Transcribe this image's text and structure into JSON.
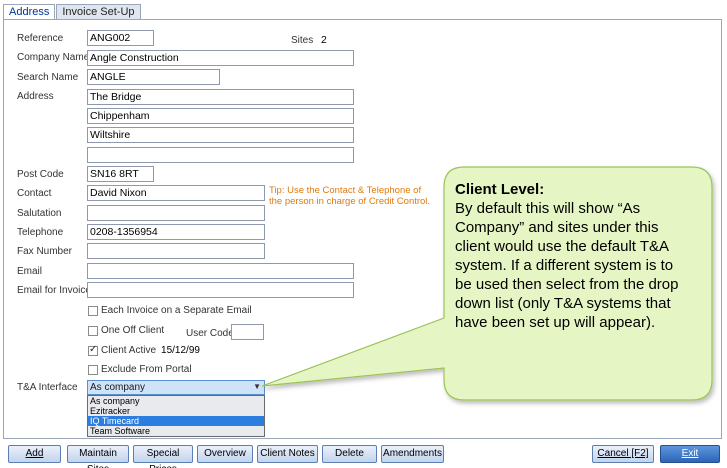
{
  "tabs": [
    "Address",
    "Invoice Set-Up"
  ],
  "form": {
    "reference_label": "Reference",
    "reference_value": "ANG002",
    "sites_label": "Sites",
    "sites_value": "2",
    "company_label": "Company Name",
    "company_value": "Angle Construction",
    "search_label": "Search Name",
    "search_value": "ANGLE",
    "address_label": "Address",
    "address_lines": [
      "The Bridge",
      "Chippenham",
      "Wiltshire",
      ""
    ],
    "postcode_label": "Post Code",
    "postcode_value": "SN16 8RT",
    "contact_label": "Contact",
    "contact_value": "David Nixon",
    "tip": "Tip: Use the Contact & Telephone of the person in charge of Credit Control.",
    "salutation_label": "Salutation",
    "salutation_value": "",
    "telephone_label": "Telephone",
    "telephone_value": "0208-1356954",
    "fax_label": "Fax Number",
    "fax_value": "",
    "email_label": "Email",
    "email_value": "",
    "email_invoices_label": "Email for Invoices",
    "email_invoices_value": "",
    "each_invoice_label": "Each Invoice on a Separate Email",
    "one_off_label": "One Off Client",
    "user_code_label": "User Code",
    "user_code_value": "",
    "client_active_label": "Client Active",
    "client_active_date": "15/12/99",
    "exclude_portal_label": "Exclude From Portal",
    "ta_label": "T&A Interface",
    "ta_selected": "As company",
    "ta_options": [
      "As company",
      "Ezitracker",
      "IQ Timecard",
      "Team Software"
    ],
    "ta_highlighted_index": 2
  },
  "callout": {
    "title": "Client Level:",
    "body": "By default this will show “As Company” and sites under this client would use the default T&A system. If a different system is to be used then select from the drop down list (only T&A systems that have been set up will appear)."
  },
  "buttons": {
    "add": "Add",
    "maintain_sites": "Maintain Sites",
    "special_prices": "Special Prices",
    "overview": "Overview",
    "client_notes": "Client Notes",
    "delete": "Delete",
    "amendments": "Amendments",
    "cancel": "Cancel [F2]",
    "exit": "Exit"
  },
  "colors": {
    "callout_fill": "#e6f5c4",
    "callout_stroke": "#9bc256",
    "tip_text": "#e07a10",
    "dropdown_highlight": "#2b7de0"
  }
}
